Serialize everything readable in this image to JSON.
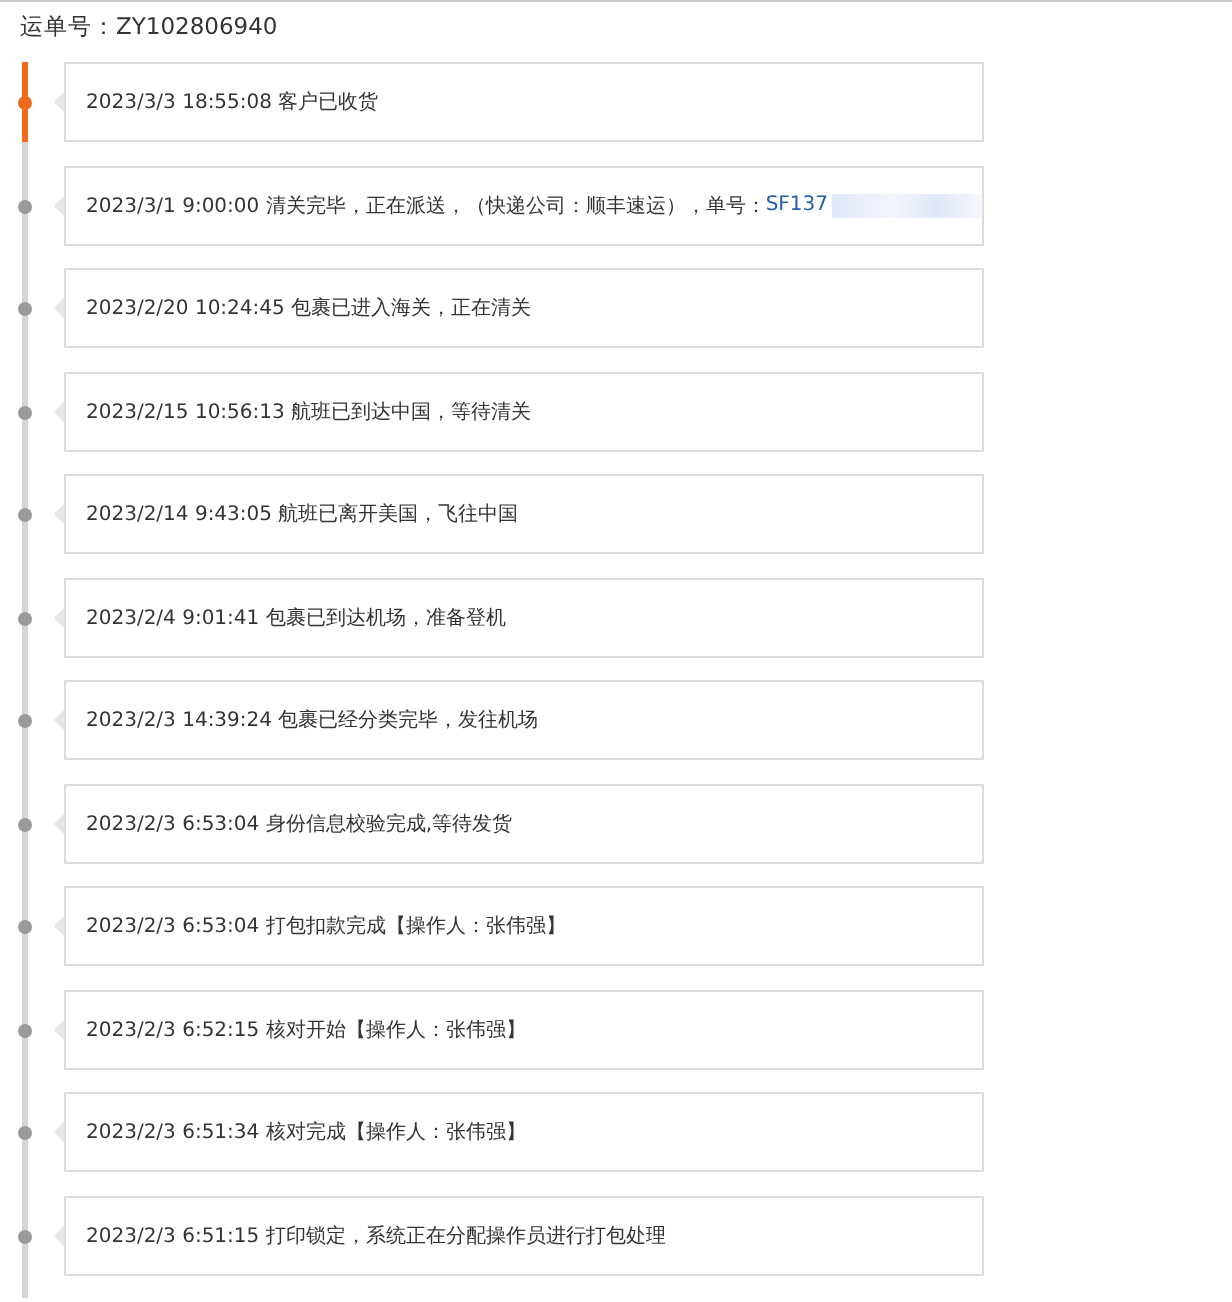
{
  "order": {
    "label": "运单号：",
    "number": "ZY102806940"
  },
  "events": [
    {
      "time": "2023/3/3 18:55:08",
      "text": "客户已收货",
      "selected": true
    },
    {
      "time": "2023/3/1 9:00:00",
      "text": "清关完毕，正在派送，（快递公司：顺丰速运），单号：",
      "link": "SF137",
      "selected": false
    },
    {
      "time": "2023/2/20 10:24:45",
      "text": "包裹已进入海关，正在清关",
      "selected": false
    },
    {
      "time": "2023/2/15 10:56:13",
      "text": "航班已到达中国，等待清关",
      "selected": false
    },
    {
      "time": "2023/2/14 9:43:05",
      "text": "航班已离开美国，飞往中国",
      "selected": false
    },
    {
      "time": "2023/2/4 9:01:41",
      "text": "包裹已到达机场，准备登机",
      "selected": false
    },
    {
      "time": "2023/2/3 14:39:24",
      "text": "包裹已经分类完毕，发往机场",
      "selected": false
    },
    {
      "time": "2023/2/3 6:53:04",
      "text": "身份信息校验完成,等待发货",
      "selected": false
    },
    {
      "time": "2023/2/3 6:53:04",
      "text": "打包扣款完成【操作人：张伟强】",
      "selected": false
    },
    {
      "time": "2023/2/3 6:52:15",
      "text": "核对开始【操作人：张伟强】",
      "selected": false
    },
    {
      "time": "2023/2/3 6:51:34",
      "text": "核对完成【操作人：张伟强】",
      "selected": false
    },
    {
      "time": "2023/2/3 6:51:15",
      "text": "打印锁定，系统正在分配操作员进行打包处理",
      "selected": false
    }
  ]
}
